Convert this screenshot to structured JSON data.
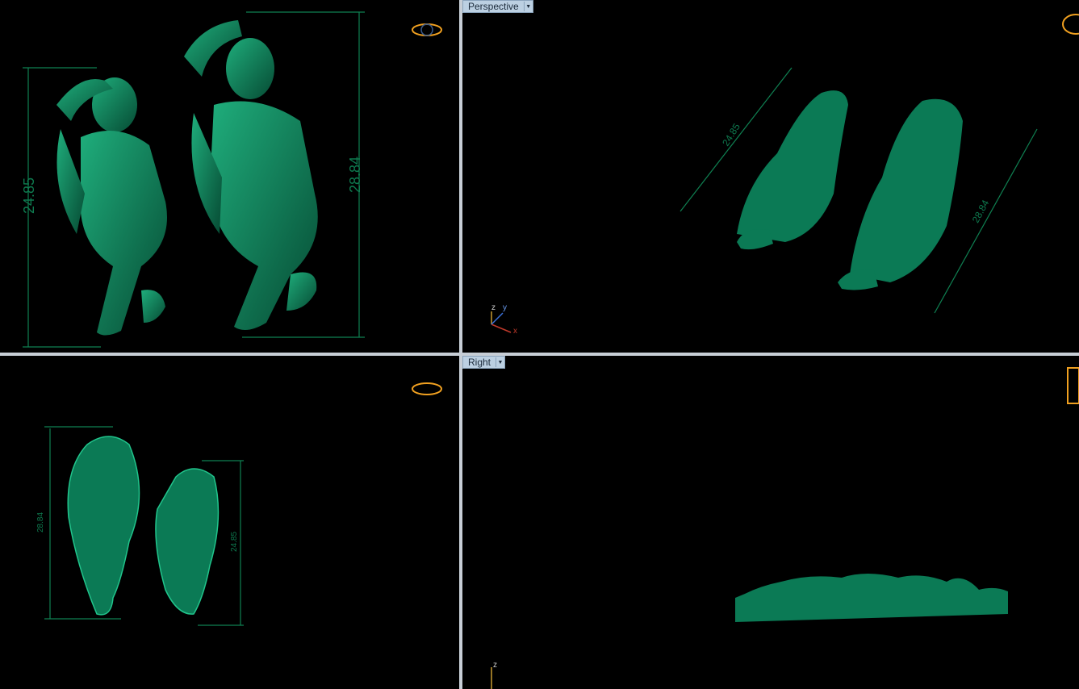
{
  "viewports": {
    "perspective": {
      "label": "Perspective",
      "menu_icon": "dropdown-arrow"
    },
    "right": {
      "label": "Right",
      "menu_icon": "dropdown-arrow"
    }
  },
  "dimensions": {
    "top_left": "24.85",
    "top_right": "28.84",
    "persp_left": "24.85",
    "persp_right": "28.84",
    "front_left": "28.84",
    "front_right": "24.85"
  },
  "axes": {
    "persp": {
      "x": "x",
      "y": "y",
      "z": "z"
    },
    "right": {
      "z": "z"
    }
  },
  "colors": {
    "model": "#0b7a55",
    "dimension": "#0f8052",
    "divider": "#c7ced6",
    "tab_bg": "#bcd0e2",
    "gumball": "#f0a020"
  }
}
